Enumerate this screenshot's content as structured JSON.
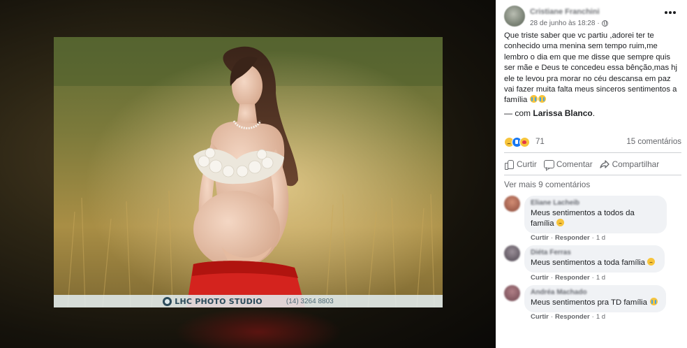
{
  "photo": {
    "watermark_brand": "LHC PHOTO STUDIO",
    "watermark_phone": "(14) 3264 8803"
  },
  "post": {
    "author": "Cristiane Franchini",
    "timestamp": "28 de junho às 18:28",
    "text": "Que triste saber que vc partiu ,adorei ter te conhecido uma menina sem tempo ruim,me lembro o dia em que me disse que sempre quis ser mãe e Deus te concedeu essa bênção,mas hj ele te levou pra morar no céu descansa em paz vai fazer muita falta meus sinceros sentimentos a família",
    "with_prefix": "— com",
    "with_name": "Larissa Blanco",
    "with_suffix": ".",
    "reactions": [
      "sad",
      "like",
      "love"
    ],
    "reaction_count": "71",
    "comment_count": "15 comentários"
  },
  "actions": {
    "like": "Curtir",
    "comment": "Comentar",
    "share": "Compartilhar"
  },
  "more_comments": "Ver mais 9 comentários",
  "comments": [
    {
      "author": "Eliane Lacheib",
      "text": "Meus sentimentos a todos da família",
      "emoji": "sad-face-icon",
      "like": "Curtir",
      "reply": "Responder",
      "age": "1 d"
    },
    {
      "author": "Diéta Ferras",
      "text": "Meus sentimentos a toda família",
      "emoji": "sad-face-icon",
      "like": "Curtir",
      "reply": "Responder",
      "age": "1 d"
    },
    {
      "author": "Andréa Machado",
      "text": "Meus sentimentos pra TD família",
      "emoji": "crying-face-icon",
      "like": "Curtir",
      "reply": "Responder",
      "age": "1 d"
    }
  ],
  "colors": {
    "accent_blue": "#1877f2",
    "text_secondary": "#65676b",
    "bubble_bg": "#f0f2f5"
  }
}
